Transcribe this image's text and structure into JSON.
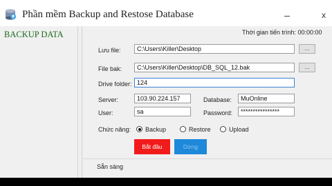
{
  "window": {
    "title": "Phần mềm Backup and Restose Database",
    "minimize_glyph": "–",
    "close_glyph": "x",
    "icon": "database-backup-icon"
  },
  "sidebar": {
    "title": "BACKUP DATA"
  },
  "timer": "Thời gian tiến trình: 00:00:00",
  "form": {
    "luu_file_label": "Lưu file:",
    "luu_file_value": "C:\\Users\\Killer\\Desktop",
    "file_bak_label": "File bak:",
    "file_bak_value": "C:\\Users\\Killer\\Desktop\\DB_SQL_12.bak",
    "browse_label": "...",
    "drive_label": "Drive folder:",
    "drive_value": "124",
    "server_label": "Server:",
    "server_value": "103.90.224.157",
    "database_label": "Database:",
    "database_value": "MuOnline",
    "user_label": "User:",
    "user_value": "sa",
    "password_label": "Password:",
    "password_value": "****************"
  },
  "function": {
    "label": "Chức năng:",
    "options": [
      "Backup",
      "Restore",
      "Upload"
    ],
    "selected": "Backup"
  },
  "buttons": {
    "start": "Bắt đầu",
    "stop": "Dừng"
  },
  "status": "Sẵn sàng",
  "colors": {
    "start_button": "#f21b1b",
    "stop_button": "#1e88d9",
    "sidebar_title": "#1a6b1a"
  }
}
